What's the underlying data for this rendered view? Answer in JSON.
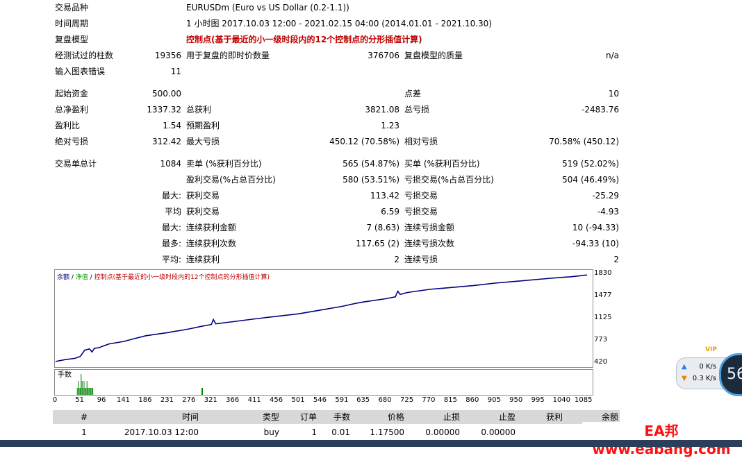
{
  "summary": {
    "symbol_label": "交易品种",
    "symbol_value": "EURUSDm (Euro vs US Dollar (0.2-1.1))",
    "period_label": "时间周期",
    "period_value": "1 小时图 2017.10.03 12:00 - 2021.02.15 04:00 (2014.01.01 - 2021.10.30)",
    "model_label": "复盘模型",
    "model_value": "控制点(基于最近的小一级时段内的12个控制点的分形插值计算)",
    "bars_label": "经测试过的柱数",
    "bars_value": "19356",
    "ticks_label": "用于复盘的即时价数量",
    "ticks_value": "376706",
    "quality_label": "复盘模型的质量",
    "quality_value": "n/a",
    "errors_label": "输入图表错误",
    "errors_value": "11",
    "deposit_label": "起始资金",
    "deposit_value": "500.00",
    "spread_label": "点差",
    "spread_value": "10",
    "net_label": "总净盈利",
    "net_value": "1337.32",
    "gross_profit_label": "总获利",
    "gross_profit_value": "3821.08",
    "gross_loss_label": "总亏损",
    "gross_loss_value": "-2483.76",
    "pf_label": "盈利比",
    "pf_value": "1.54",
    "payoff_label": "预期盈利",
    "payoff_value": "1.23",
    "abs_dd_label": "绝对亏损",
    "abs_dd_value": "312.42",
    "max_dd_label": "最大亏损",
    "max_dd_value": "450.12 (70.58%)",
    "rel_dd_label": "相对亏损",
    "rel_dd_value": "70.58% (450.12)",
    "total_trades_label": "交易单总计",
    "total_trades_value": "1084",
    "short_label": "卖单 (%获利百分比)",
    "short_value": "565 (54.87%)",
    "long_label": "买单 (%获利百分比)",
    "long_value": "519 (52.02%)",
    "profit_trades_label": "盈利交易(%占总百分比)",
    "profit_trades_value": "580 (53.51%)",
    "loss_trades_label": "亏损交易(%占总百分比)",
    "loss_trades_value": "504 (46.49%)",
    "max_prefix": "最大:",
    "avg_prefix": "平均",
    "most_prefix": "最多:",
    "avg2_prefix": "平均:",
    "largest_profit_label": "获利交易",
    "largest_profit_value": "113.42",
    "largest_loss_label": "亏损交易",
    "largest_loss_value": "-25.29",
    "avg_profit_label": "获利交易",
    "avg_profit_value": "6.59",
    "avg_loss_label": "亏损交易",
    "avg_loss_value": "-4.93",
    "max_cons_wins_label": "连续获利金额",
    "max_cons_wins_value": "7 (8.63)",
    "max_cons_losses_label": "连续亏损金额",
    "max_cons_losses_value": "10 (-94.33)",
    "max_cons_profit_label": "连续获利次数",
    "max_cons_profit_value": "117.65 (2)",
    "max_cons_loss_label": "连续亏损次数",
    "max_cons_loss_value": "-94.33 (10)",
    "avg_cons_wins_label": "连续获利",
    "avg_cons_wins_value": "2",
    "avg_cons_losses_label": "连续亏损",
    "avg_cons_losses_value": "2"
  },
  "chart_legend": {
    "balance": "余额",
    "sep1": " / ",
    "equity": "净值",
    "sep2": " / ",
    "model": "控制点(基于最近的小一级时段内的12个控制点的分形插值计算)",
    "balance_color": "#000080",
    "equity_color": "#00a000",
    "model_color": "#c00000"
  },
  "volume_label": "手数",
  "chart_data": {
    "type": "line",
    "x_ticks": [
      0,
      51,
      96,
      141,
      186,
      231,
      276,
      321,
      366,
      411,
      456,
      501,
      546,
      591,
      635,
      680,
      725,
      770,
      815,
      860,
      905,
      950,
      995,
      1040,
      1085
    ],
    "y_ticks": [
      420,
      773,
      1125,
      1477,
      1830
    ],
    "xlim": [
      0,
      1105
    ],
    "ylim": [
      350,
      1900
    ],
    "series": [
      {
        "name": "余额",
        "x": [
          0,
          20,
          40,
          51,
          60,
          70,
          75,
          80,
          90,
          96,
          110,
          141,
          160,
          186,
          231,
          276,
          300,
          321,
          325,
          330,
          366,
          411,
          456,
          501,
          546,
          591,
          620,
          635,
          680,
          700,
          705,
          710,
          725,
          770,
          815,
          860,
          905,
          950,
          995,
          1040,
          1060,
          1085,
          1095
        ],
        "y": [
          440,
          470,
          490,
          520,
          620,
          640,
          590,
          650,
          660,
          680,
          720,
          760,
          800,
          850,
          900,
          960,
          1000,
          1030,
          1110,
          1040,
          1075,
          1120,
          1160,
          1200,
          1260,
          1320,
          1370,
          1390,
          1440,
          1470,
          1560,
          1510,
          1540,
          1590,
          1620,
          1650,
          1690,
          1720,
          1750,
          1780,
          1790,
          1810,
          1820
        ]
      }
    ],
    "volume": {
      "x": [
        44,
        46,
        48,
        50,
        52,
        54,
        56,
        58,
        60,
        62,
        64,
        66,
        68,
        70,
        72,
        74,
        76,
        300,
        302
      ],
      "y": [
        1,
        2,
        1,
        1,
        3,
        2,
        1,
        2,
        1,
        1,
        2,
        1,
        1,
        1,
        1,
        1,
        1,
        1,
        1
      ]
    }
  },
  "table": {
    "headers": [
      "#",
      "时间",
      "类型",
      "订单",
      "手数",
      "价格",
      "止损",
      "止盈",
      "获利",
      "余额"
    ],
    "row": [
      "1",
      "2017.10.03 12:00",
      "buy",
      "1",
      "0.01",
      "1.17500",
      "0.00000",
      "0.00000",
      "",
      ""
    ]
  },
  "speed_widget": {
    "up": "0 K/s",
    "down": "0.3 K/s",
    "number": "56",
    "vip": "VIP"
  },
  "watermark": "EA邦www.eabang.com"
}
